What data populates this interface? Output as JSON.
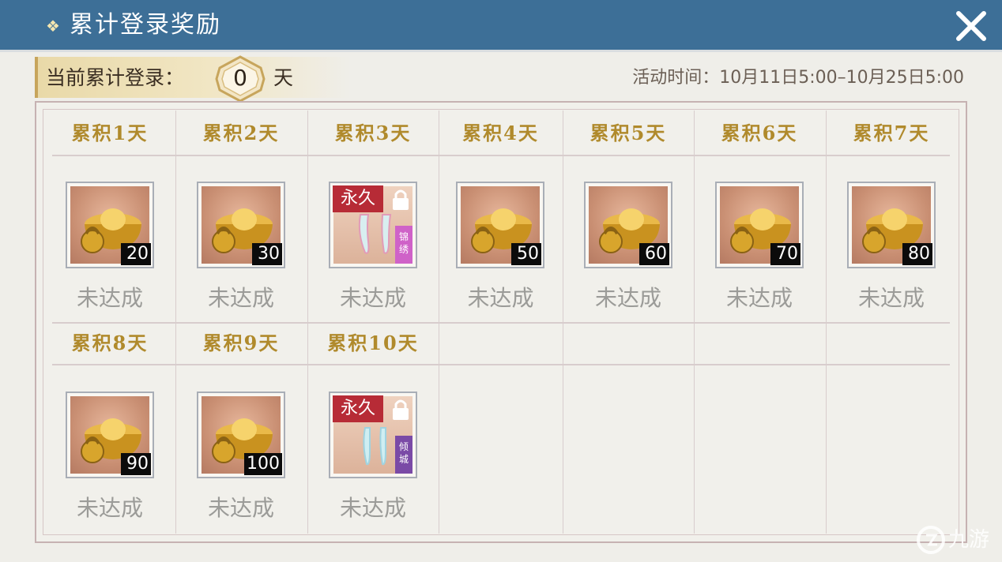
{
  "window": {
    "title": "累计登录奖励",
    "title_icon": "diamond-ornament-icon",
    "close_icon": "close-icon"
  },
  "login": {
    "label": "当前累计登录：",
    "days": "0",
    "unit": "天"
  },
  "activity_time": "活动时间：10月11日5:00–10月25日5:00",
  "colors": {
    "titlebar": "#3d6f97",
    "gold_text": "#b08a2c",
    "permanent_tag": "#b72b36",
    "status_gray": "#9b9b98"
  },
  "rewards": [
    {
      "day_label": "累积1天",
      "type": "ingot",
      "qty": "20",
      "status": "未达成"
    },
    {
      "day_label": "累积2天",
      "type": "ingot",
      "qty": "30",
      "status": "未达成"
    },
    {
      "day_label": "累积3天",
      "type": "costume",
      "tag": "永久",
      "side_tag": "锦绣",
      "status": "未达成"
    },
    {
      "day_label": "累积4天",
      "type": "ingot",
      "qty": "50",
      "status": "未达成"
    },
    {
      "day_label": "累积5天",
      "type": "ingot",
      "qty": "60",
      "status": "未达成"
    },
    {
      "day_label": "累积6天",
      "type": "ingot",
      "qty": "70",
      "status": "未达成"
    },
    {
      "day_label": "累积7天",
      "type": "ingot",
      "qty": "80",
      "status": "未达成"
    },
    {
      "day_label": "累积8天",
      "type": "ingot",
      "qty": "90",
      "status": "未达成"
    },
    {
      "day_label": "累积9天",
      "type": "ingot",
      "qty": "100",
      "status": "未达成"
    },
    {
      "day_label": "累积10天",
      "type": "costume",
      "tag": "永久",
      "side_tag": "倾城",
      "status": "未达成"
    }
  ],
  "watermark": "九游"
}
